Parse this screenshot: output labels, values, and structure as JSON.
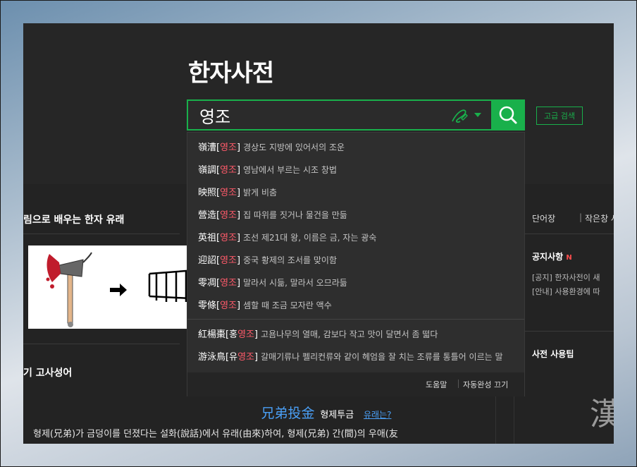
{
  "header": {
    "title": "한자사전"
  },
  "search": {
    "value": "영조",
    "advanced_label": "고급 검색"
  },
  "suggestions": [
    {
      "word": "嶺漕",
      "prefix": "",
      "hl": "영조",
      "meaning": "경상도 지방에 있어서의 조운"
    },
    {
      "word": "嶺調",
      "prefix": "",
      "hl": "영조",
      "meaning": "영남에서 부르는 시조 창법"
    },
    {
      "word": "映照",
      "prefix": "",
      "hl": "영조",
      "meaning": "밝게 비춤"
    },
    {
      "word": "營造",
      "prefix": "",
      "hl": "영조",
      "meaning": "집 따위를 짓거나 물건을 만듦"
    },
    {
      "word": "英祖",
      "prefix": "",
      "hl": "영조",
      "meaning": "조선 제21대 왕, 이름은 금, 자는 광숙"
    },
    {
      "word": "迎詔",
      "prefix": "",
      "hl": "영조",
      "meaning": "중국 황제의 조서를 맞이함"
    },
    {
      "word": "零凋",
      "prefix": "",
      "hl": "영조",
      "meaning": "말라서 시듦, 말라서 오므라듦"
    },
    {
      "word": "零條",
      "prefix": "",
      "hl": "영조",
      "meaning": "셈할 때 조금 모자란 액수"
    },
    {
      "word": "紅楊棗",
      "prefix": "홍",
      "hl": "영조",
      "meaning": "고욤나무의 열매, 감보다 작고 맛이 달면서 좀 떫다"
    },
    {
      "word": "游泳鳥",
      "prefix": "유",
      "hl": "영조",
      "meaning": "갈매기류나 펠리컨류와 같이 헤엄을 잘 치는 조류를 통틀어 이르는 말"
    }
  ],
  "dropdown_footer": {
    "help": "도움말",
    "autocomplete_off": "자동완성 끄기"
  },
  "left": {
    "section1_title": "림으로 배우는 한자 유래",
    "section2_title": "기 고사성어"
  },
  "idiom": {
    "hanja": "兄弟投金",
    "reading": "형제투금",
    "origin_link": "유래는?",
    "desc": "형제(兄弟)가 금덩이를 던졌다는 설화(說話)에서 유래(由來)하여, 형제(兄弟) 간(間)의 우애(友"
  },
  "right": {
    "wordbook": "단어장",
    "small_window": "작은창 사",
    "notice_title": "공지사항",
    "notice_new": "N",
    "notice1": "[공지] 한자사전이 새",
    "notice2": "[안내] 사용환경에 따",
    "tips_title": "사전 사용팁",
    "big_char": "漢"
  },
  "colors": {
    "accent": "#19b04b",
    "highlight": "#ff5a6a",
    "link": "#4a9ff5"
  }
}
